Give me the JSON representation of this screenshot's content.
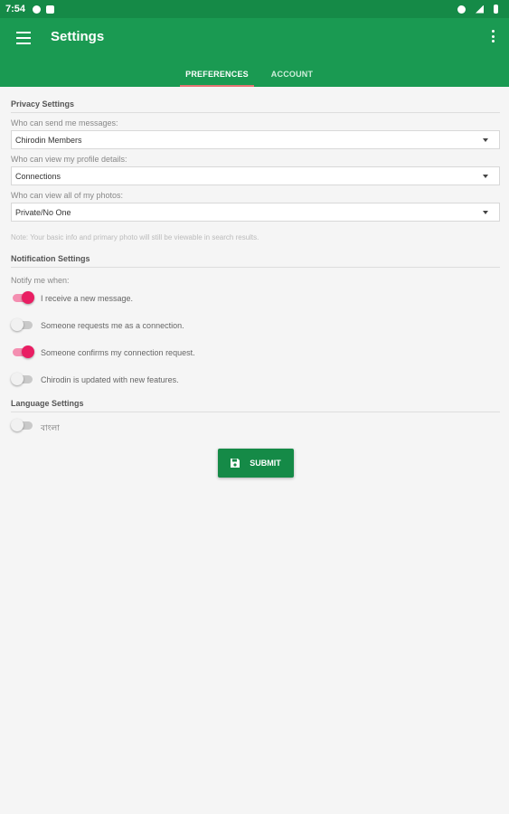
{
  "status_bar": {
    "time": "7:54"
  },
  "app_bar": {
    "title": "Settings"
  },
  "tabs": [
    {
      "label": "PREFERENCES",
      "active": true
    },
    {
      "label": "ACCOUNT",
      "active": false
    }
  ],
  "privacy": {
    "title": "Privacy Settings",
    "fields": [
      {
        "label": "Who can send me messages:",
        "value": "Chirodin Members"
      },
      {
        "label": "Who can view my profile details:",
        "value": "Connections"
      },
      {
        "label": "Who can view all of my photos:",
        "value": "Private/No One"
      }
    ],
    "note": "Note: Your basic info and primary photo will still be viewable in search results."
  },
  "notifications": {
    "title": "Notification Settings",
    "intro": "Notify me when:",
    "toggles": [
      {
        "label": "I receive a new message.",
        "on": true
      },
      {
        "label": "Someone requests me as a connection.",
        "on": false
      },
      {
        "label": "Someone confirms my connection request.",
        "on": true
      },
      {
        "label": "Chirodin is updated with new features.",
        "on": false
      }
    ]
  },
  "language": {
    "title": "Language Settings",
    "toggle": {
      "label": "বাংলা",
      "on": false
    }
  },
  "submit_label": "SUBMIT",
  "colors": {
    "primary": "#1a9a52",
    "primary_dark": "#158a47",
    "accent": "#e91e63",
    "tab_indicator": "#e57373"
  }
}
